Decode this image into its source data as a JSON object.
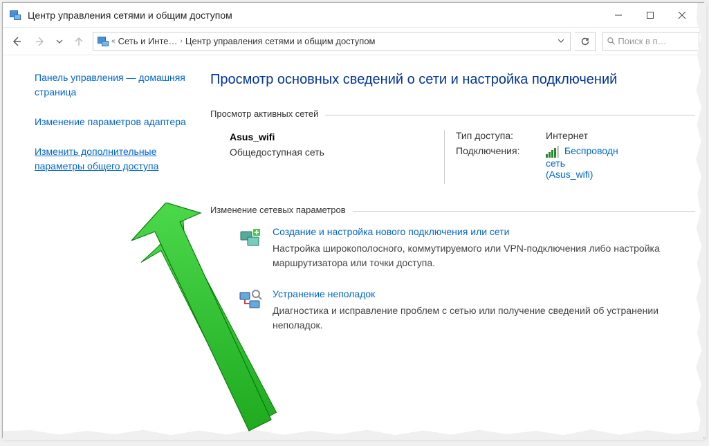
{
  "window": {
    "title": "Центр управления сетями и общим доступом"
  },
  "breadcrumb": {
    "level1": "Сеть и Инте…",
    "level2": "Центр управления сетями и общим доступом"
  },
  "search": {
    "placeholder": "Поиск в п…"
  },
  "sidebar": {
    "home": "Панель управления — домашняя страница",
    "adapter": "Изменение параметров адаптера",
    "advanced": "Изменить дополнительные параметры общего доступа"
  },
  "main": {
    "heading": "Просмотр основных сведений о сети и настройка подключений",
    "active_networks_label": "Просмотр активных сетей",
    "network": {
      "name": "Asus_wifi",
      "category": "Общедоступная сеть",
      "access_type_label": "Тип доступа:",
      "access_type_value": "Интернет",
      "connections_label": "Подключения:",
      "conn_line1": "Беспроводн",
      "conn_line2": "сеть",
      "conn_line3": "(Asus_wifi)"
    },
    "change_settings_label": "Изменение сетевых параметров",
    "action1": {
      "link": "Создание и настройка нового подключения или сети",
      "desc": "Настройка широкополосного, коммутируемого или VPN-подключения либо настройка маршрутизатора или точки доступа."
    },
    "action2": {
      "link": "Устранение неполадок",
      "desc": "Диагностика и исправление проблем с сетью или получение сведений об устранении неполадок."
    }
  }
}
